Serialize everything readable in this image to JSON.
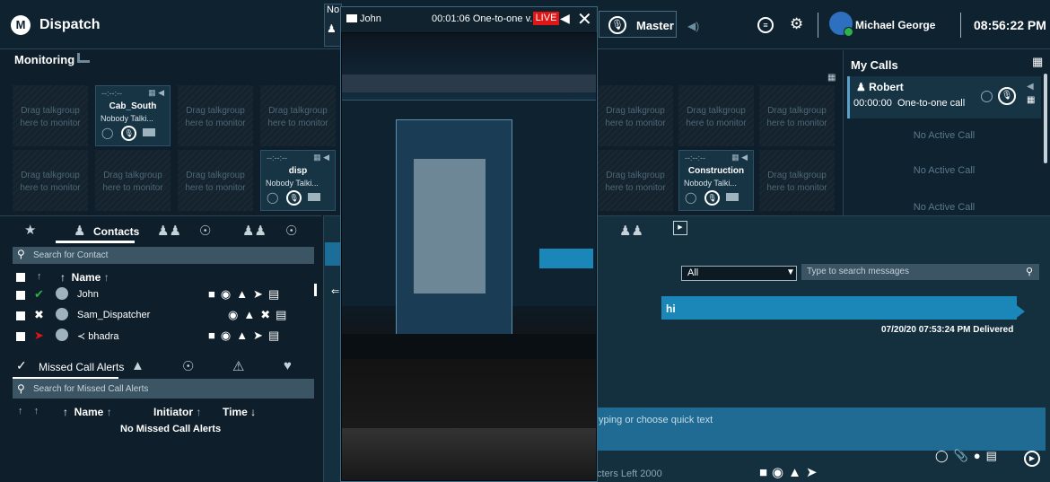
{
  "header": {
    "app_title": "Dispatch",
    "logo_letter": "M",
    "partial_tab_text": "No",
    "master_label": "Master",
    "user_name": "Michael George",
    "clock": "08:56:22 PM"
  },
  "monitoring": {
    "title": "Monitoring",
    "empty_slot_text": "Drag talkgroup here to monitor",
    "talkgroups": [
      {
        "name": "Cab_South",
        "status": "Nobody Talki..."
      },
      {
        "name": "disp",
        "status": "Nobody Talki..."
      },
      {
        "name": "Construction",
        "status": "Nobody Talki..."
      }
    ],
    "dash_text": "--:--:--"
  },
  "my_calls": {
    "title": "My Calls",
    "active_call": {
      "caller": "Robert",
      "time": "00:00:00",
      "type": "One-to-one call"
    },
    "empty_text": "No Active Call"
  },
  "contacts": {
    "tab_label": "Contacts",
    "search_placeholder": "Search for Contact",
    "column_name": "Name",
    "rows": [
      {
        "name": "John",
        "status_color": "#2bb34a"
      },
      {
        "name": "Sam_Dispatcher",
        "status_color": "#ffffff"
      },
      {
        "name": "bhadra",
        "status_color": "#e01515"
      }
    ]
  },
  "missed_calls": {
    "tab_label": "Missed Call Alerts",
    "search_placeholder": "Search for Missed Call Alerts",
    "col_name": "Name",
    "col_initiator": "Initiator",
    "col_time": "Time",
    "empty_text": "No Missed Call Alerts"
  },
  "chat": {
    "filter_value": "All",
    "search_placeholder": "Type to search messages",
    "message_text": "hi",
    "message_meta": "07/20/20 07:53:24 PM Delivered",
    "compose_placeholder": "yping or choose quick text",
    "char_count": "cters Left 2000"
  },
  "video": {
    "name": "John",
    "time": "00:01:06 One-to-one v...",
    "live": "LIVE"
  }
}
